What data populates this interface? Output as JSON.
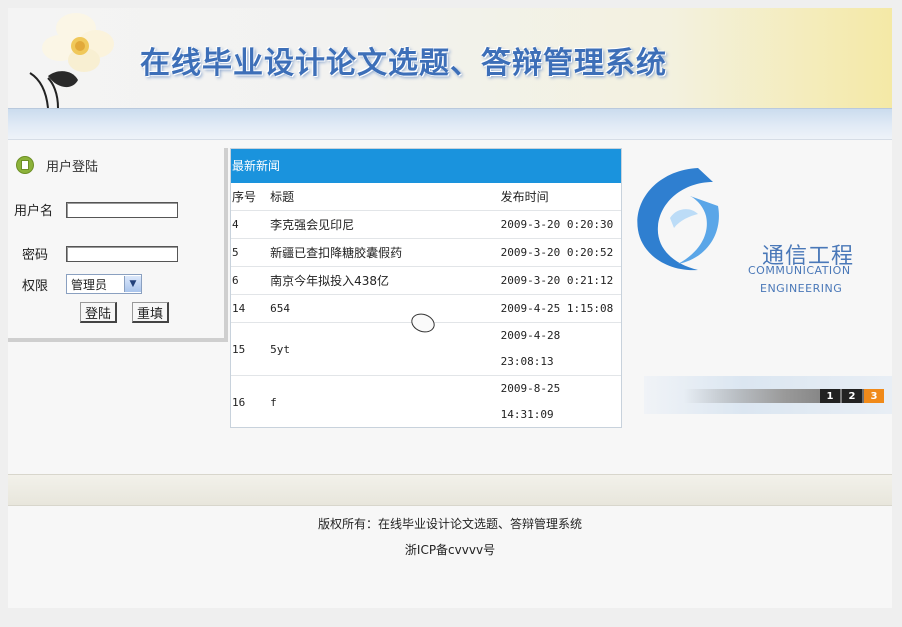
{
  "header": {
    "title": "在线毕业设计论文选题、答辩管理系统"
  },
  "login": {
    "heading": "用户登陆",
    "username_label": "用户名",
    "username_value": "",
    "password_label": "密码",
    "password_value": "",
    "role_label": "权限",
    "role_selected": "管理员",
    "login_button": "登陆",
    "reset_button": "重填"
  },
  "news": {
    "heading": "最新新闻",
    "columns": [
      "序号",
      "标题",
      "发布时间"
    ],
    "rows": [
      {
        "id": "4",
        "title": "李克强会见印尼",
        "time": "2009-3-20 0:20:30"
      },
      {
        "id": "5",
        "title": "新疆已查扣降糖胶囊假药",
        "time": "2009-3-20 0:20:52"
      },
      {
        "id": "6",
        "title": "南京今年拟投入438亿",
        "time": "2009-3-20 0:21:12"
      },
      {
        "id": "14",
        "title": "654",
        "time": "2009-4-25 1:15:08"
      },
      {
        "id": "15",
        "title": "5yt",
        "time_date": "2009-4-28",
        "time_clock": "23:08:13"
      },
      {
        "id": "16",
        "title": "f",
        "time_date": "2009-8-25",
        "time_clock": "14:31:09"
      }
    ]
  },
  "brand": {
    "cn": "通信工程",
    "en_line1": "COMMUNICATION",
    "en_line2": "ENGINEERING",
    "accent_color": "#2f7fd0"
  },
  "pager": {
    "pages": [
      "1",
      "2",
      "3"
    ],
    "active": "3"
  },
  "footer": {
    "copyright": "版权所有：在线毕业设计论文选题、答辩管理系统",
    "icp": "浙ICP备cvvvv号"
  }
}
